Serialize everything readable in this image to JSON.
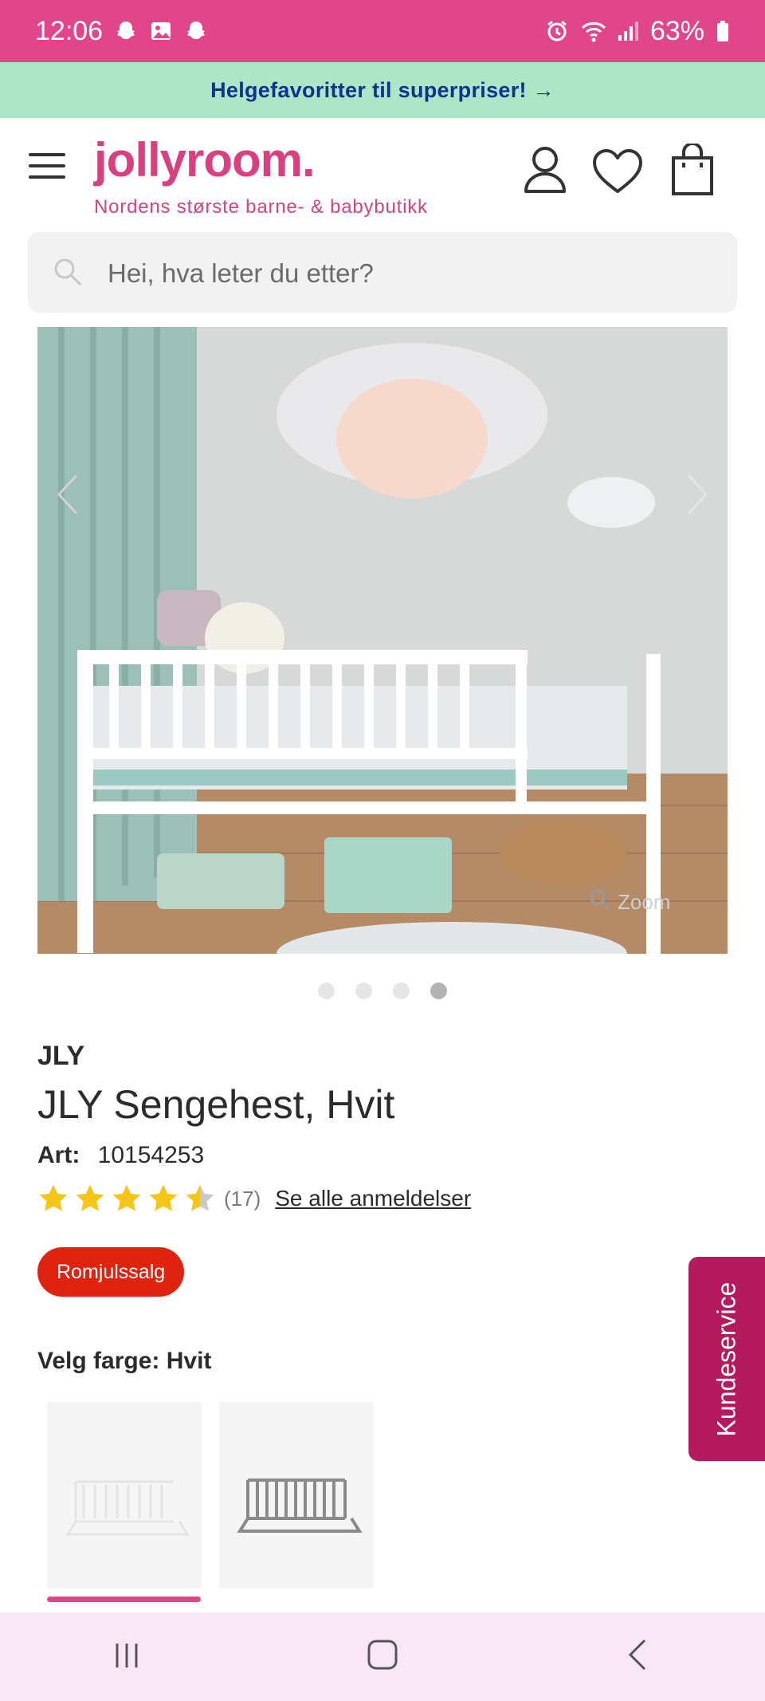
{
  "status_bar": {
    "time": "12:06",
    "battery": "63%",
    "left_icons": [
      "snapchat-icon",
      "gallery-icon",
      "snapchat-icon"
    ],
    "right_icons": [
      "alarm-icon",
      "wifi-icon",
      "signal-icon",
      "battery-icon"
    ]
  },
  "promo": {
    "text": "Helgefavoritter til superpriser! →"
  },
  "header": {
    "logo": "jollyroom.",
    "tagline": "Nordens største barne- & babybutikk",
    "icons": [
      "menu-icon",
      "account-icon",
      "heart-icon",
      "cart-icon"
    ]
  },
  "search": {
    "placeholder": "Hei, hva leter du etter?"
  },
  "gallery": {
    "zoom_label": "Zoom",
    "slide_count": 4,
    "active_slide": 4
  },
  "product": {
    "brand": "JLY",
    "title": "JLY Sengehest, Hvit",
    "art_label": "Art:",
    "art_number": "10154253",
    "rating": 4.5,
    "rating_max": 5,
    "review_count": "(17)",
    "reviews_link": "Se alle anmeldelser",
    "badge": "Romjulssalg"
  },
  "color_picker": {
    "label": "Velg farge: Hvit",
    "options": [
      "Hvit",
      "Grå"
    ],
    "selected": "Hvit"
  },
  "kundeservice": {
    "label": "Kundeservice"
  },
  "colors": {
    "status_bar": "#e2468a",
    "promo_bg": "#ade6c6",
    "promo_text": "#10318f",
    "brand_pink": "#d9407f",
    "badge_red": "#e0230e",
    "star_yellow": "#f5c518",
    "kundeservice_bg": "#b51a5f",
    "nav_bar_bg": "#f9e7f6"
  }
}
